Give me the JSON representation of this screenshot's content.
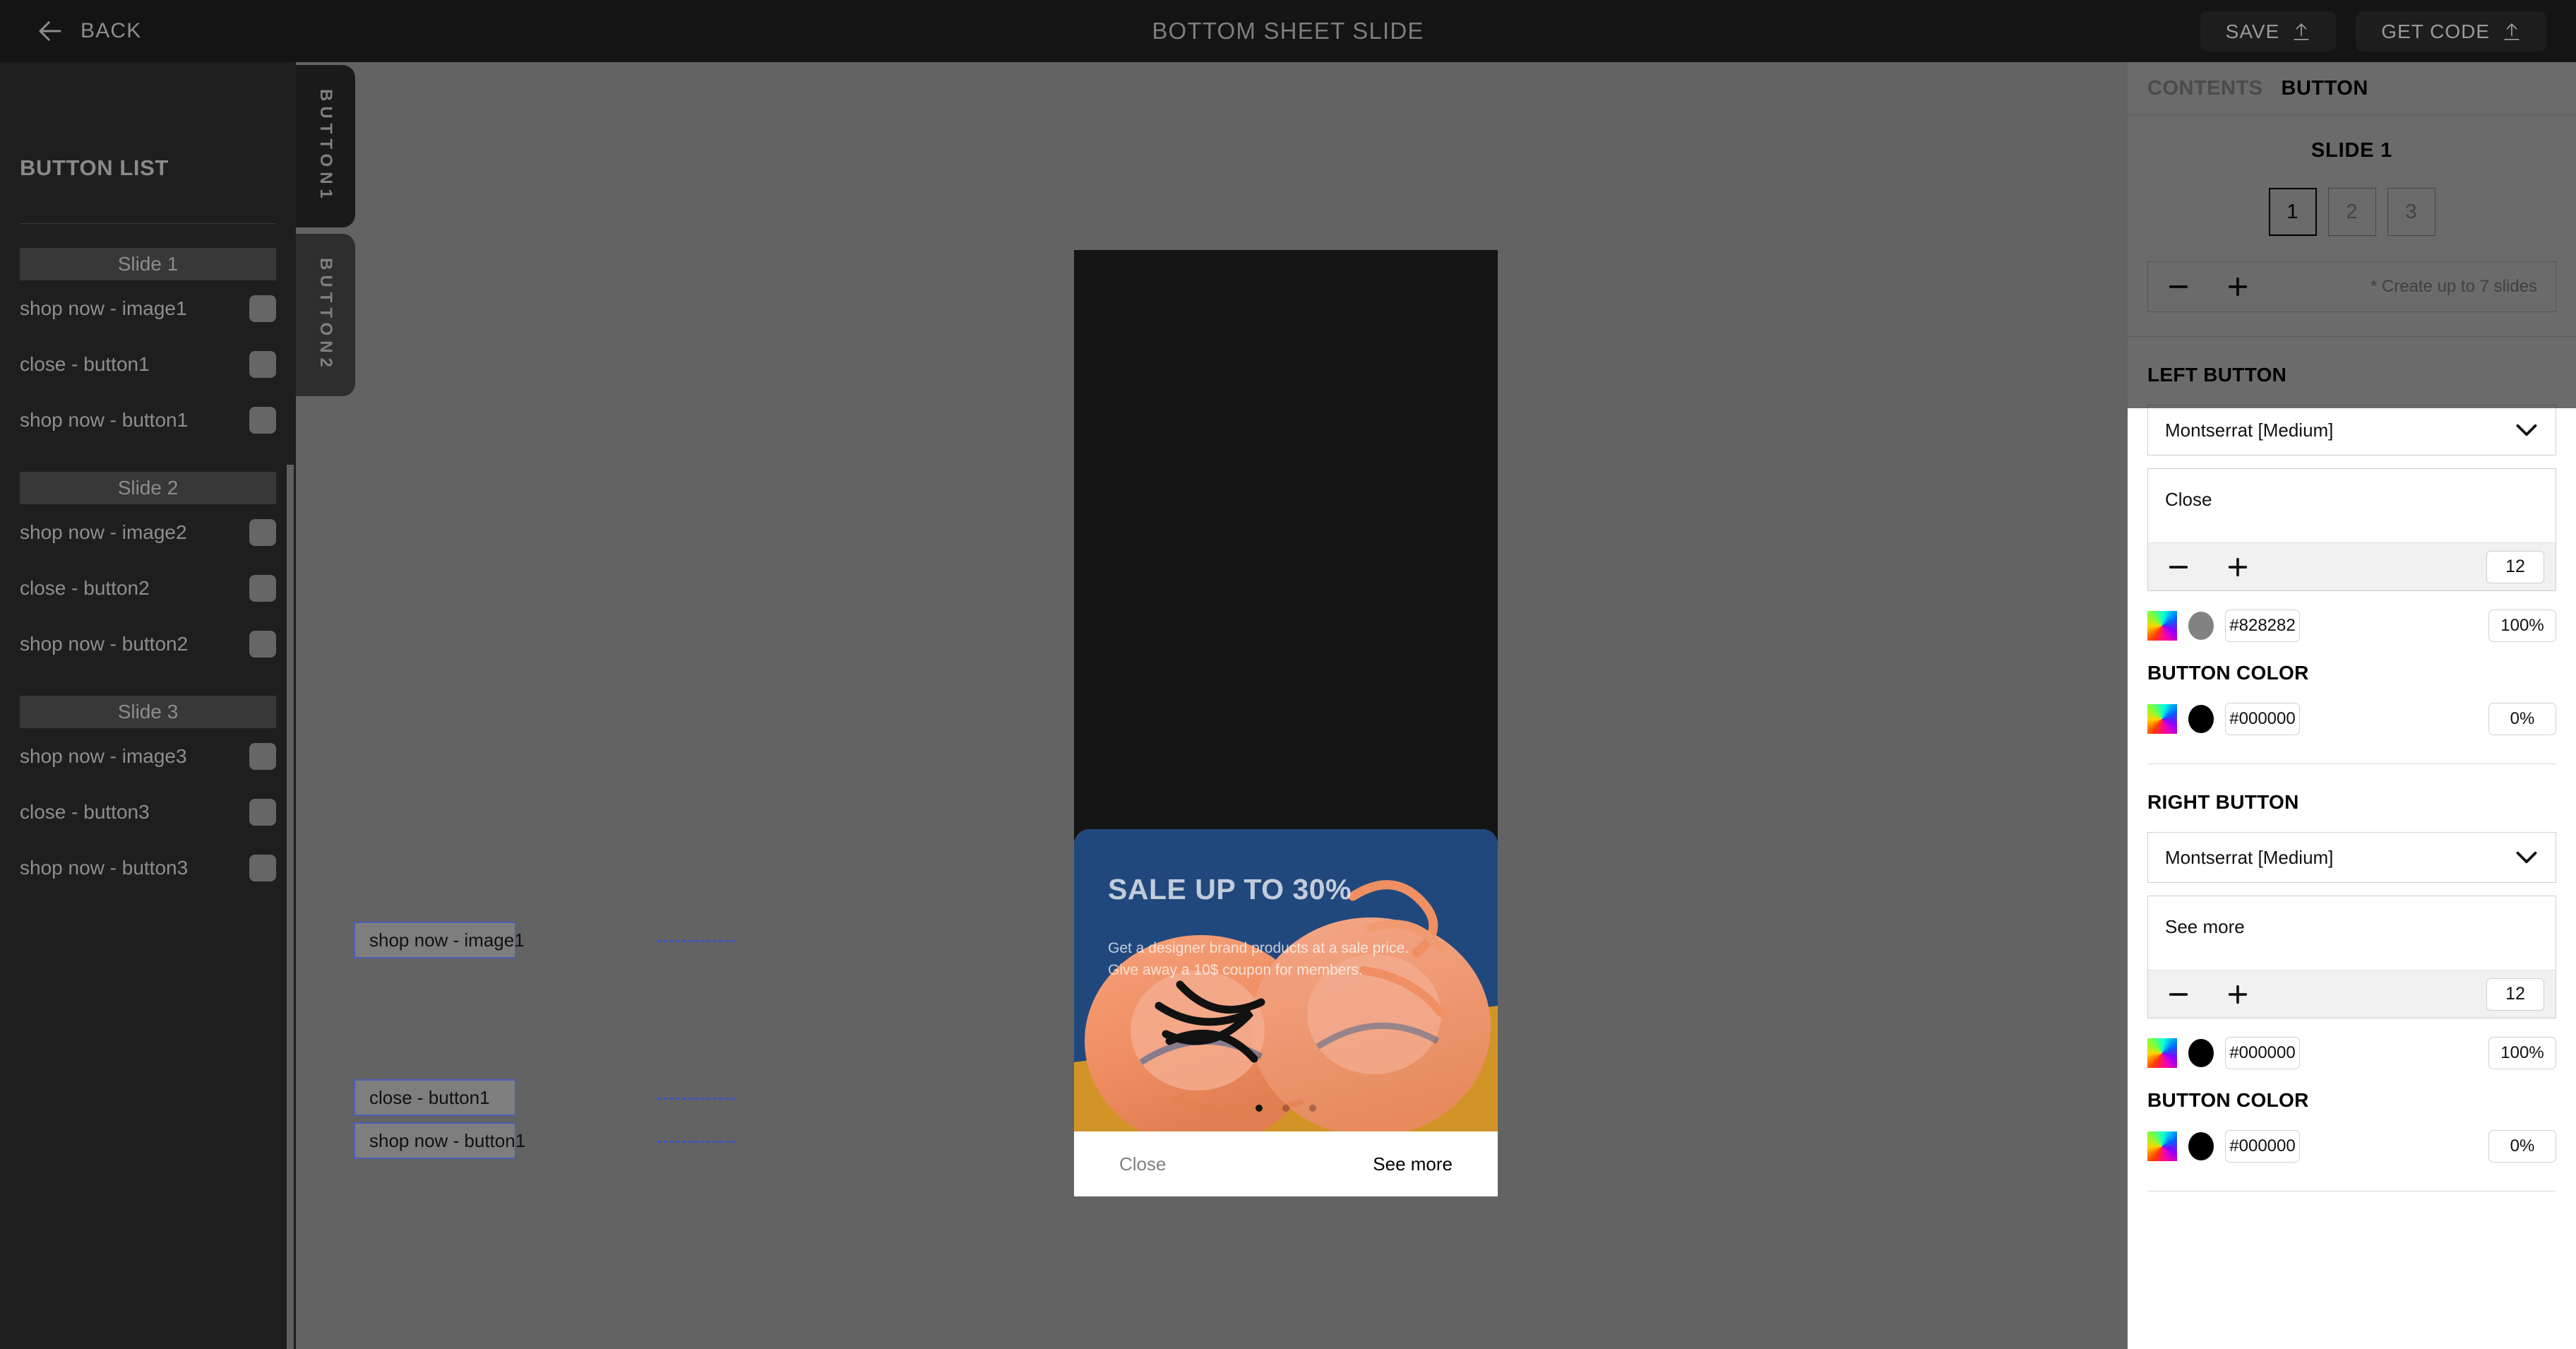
{
  "topbar": {
    "back_label": "BACK",
    "back_icon": "arrow-left-icon",
    "title": "BOTTOM SHEET SLIDE",
    "save_label": "SAVE",
    "save_icon": "upload-icon",
    "get_code_label": "GET CODE",
    "get_code_icon": "upload-icon"
  },
  "sidebar": {
    "title": "BUTTON LIST",
    "groups": [
      {
        "header": "Slide 1",
        "items": [
          {
            "label": "shop now - image1"
          },
          {
            "label": "close - button1"
          },
          {
            "label": "shop now - button1"
          }
        ]
      },
      {
        "header": "Slide 2",
        "items": [
          {
            "label": "shop now - image2"
          },
          {
            "label": "close - button2"
          },
          {
            "label": "shop now - button2"
          }
        ]
      },
      {
        "header": "Slide 3",
        "items": [
          {
            "label": "shop now - image3"
          },
          {
            "label": "close - button3"
          },
          {
            "label": "shop now - button3"
          }
        ]
      }
    ]
  },
  "vtabs": [
    {
      "label": "BUTTON1",
      "active": true
    },
    {
      "label": "BUTTON2",
      "active": false
    }
  ],
  "canvas": {
    "annotations": [
      {
        "label": "shop now - image1",
        "icon": "pencil-icon"
      },
      {
        "label": "close - button1",
        "icon": "pencil-icon"
      },
      {
        "label": "shop now - button1",
        "icon": "pencil-icon"
      }
    ],
    "preview": {
      "hero_title": "SALE UP TO 30%",
      "hero_sub_line1": "Get a designer brand products at a sale price.",
      "hero_sub_line2": "Give away a 10$ coupon for members.",
      "dot_count": 3,
      "active_dot": 1,
      "close_label": "Close",
      "see_more_label": "See more"
    }
  },
  "rightpanel": {
    "tabs": [
      {
        "label": "CONTENTS",
        "active": false
      },
      {
        "label": "BUTTON",
        "active": true
      }
    ],
    "slide_section": {
      "title": "SLIDE 1",
      "numbers": [
        {
          "label": "1",
          "active": true
        },
        {
          "label": "2",
          "active": false
        },
        {
          "label": "3",
          "active": false
        }
      ],
      "minus_icon": "minus-icon",
      "plus_icon": "plus-icon",
      "hint": "* Create up to 7 slides"
    },
    "left_button": {
      "section_title": "LEFT BUTTON",
      "font_family": "Montserrat [Medium]",
      "dropdown_icon": "chevron-down-icon",
      "text_value": "Close",
      "minus_icon": "minus-icon",
      "plus_icon": "plus-icon",
      "font_size": "12",
      "text_color_hex": "#828282",
      "text_color_swatch": "#828282",
      "text_color_opacity": "100%",
      "button_color_title": "BUTTON COLOR",
      "button_color_hex": "#000000",
      "button_color_swatch": "#000000",
      "button_color_opacity": "0%"
    },
    "right_button": {
      "section_title": "RIGHT BUTTON",
      "font_family": "Montserrat [Medium]",
      "dropdown_icon": "chevron-down-icon",
      "text_value": "See more",
      "minus_icon": "minus-icon",
      "plus_icon": "plus-icon",
      "font_size": "12",
      "text_color_hex": "#000000",
      "text_color_swatch": "#000000",
      "text_color_opacity": "100%",
      "button_color_title": "BUTTON COLOR",
      "button_color_hex": "#000000",
      "button_color_swatch": "#000000",
      "button_color_opacity": "0%"
    }
  }
}
